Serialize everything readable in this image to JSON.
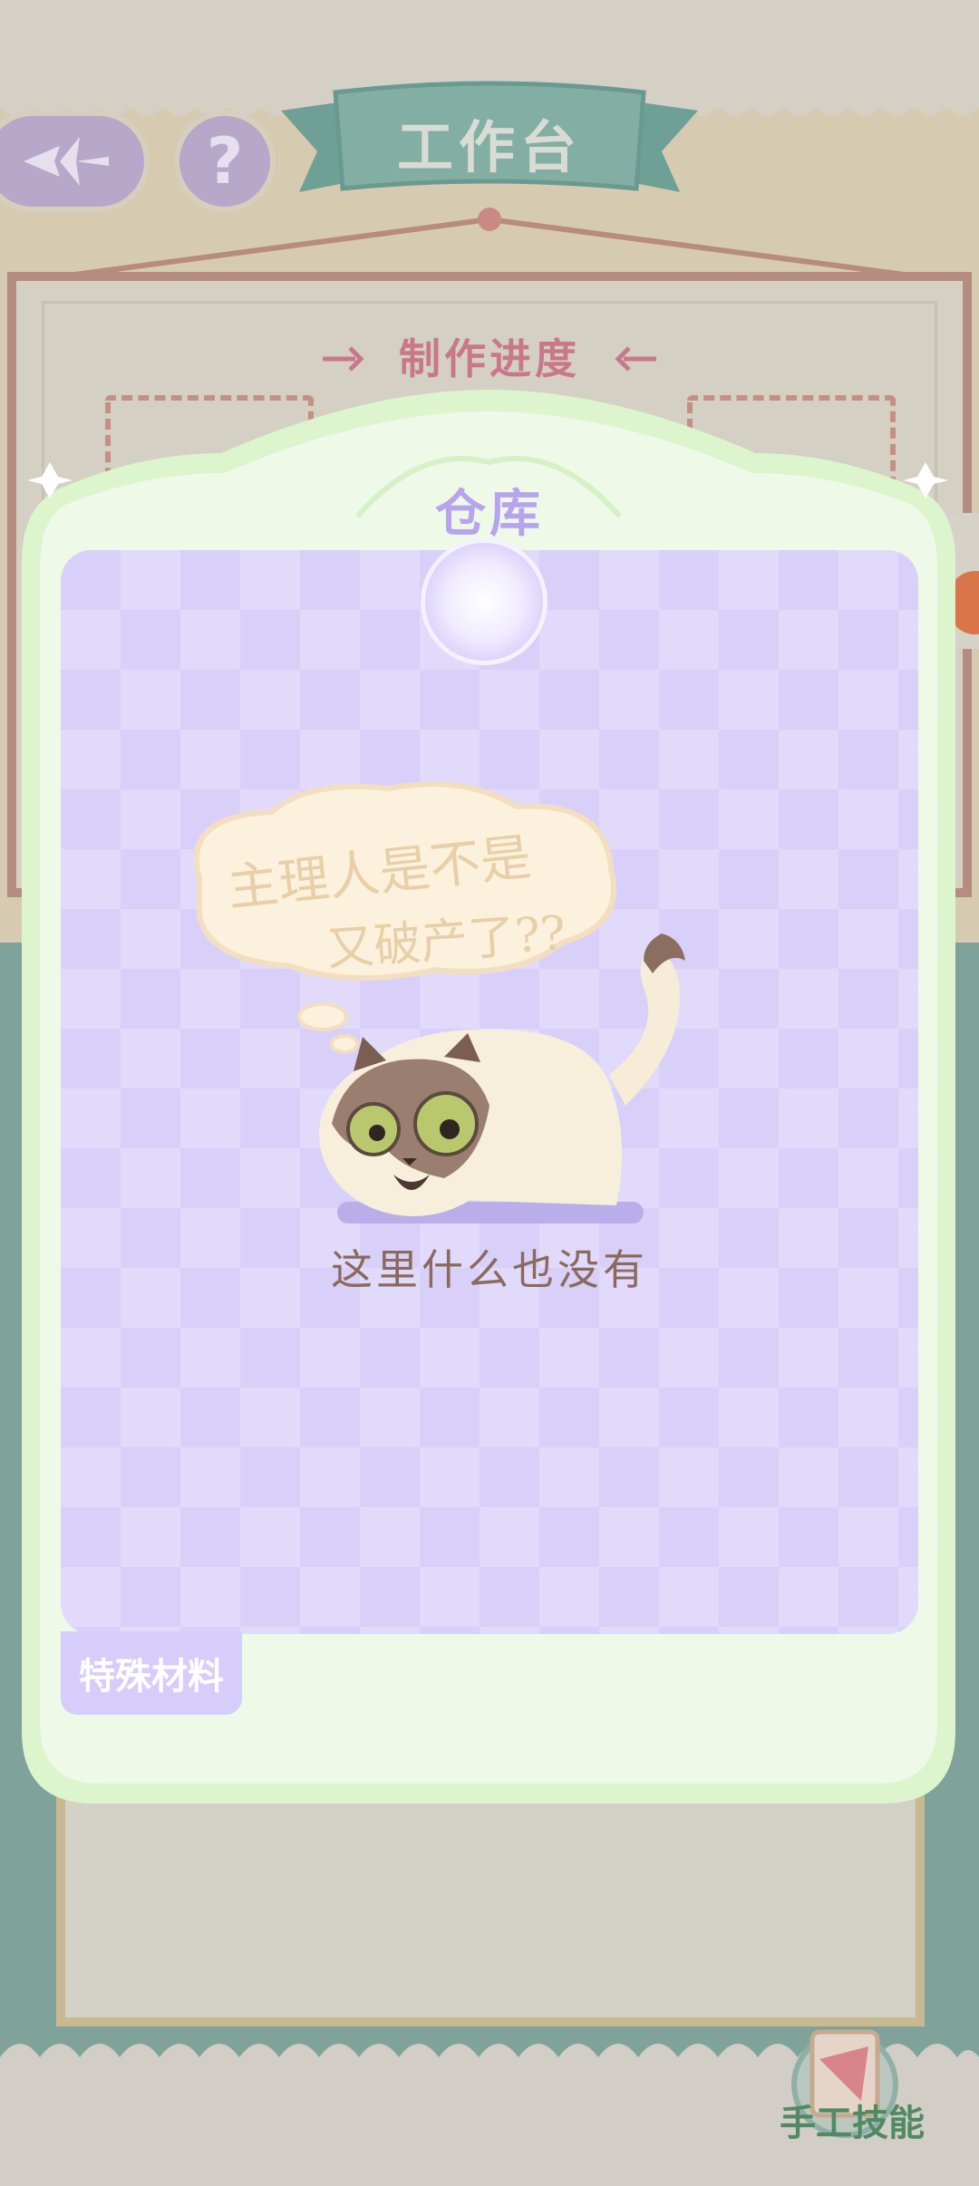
{
  "header": {
    "title": "工作台",
    "help_label": "?"
  },
  "board": {
    "progress_title": "制作进度"
  },
  "warehouse": {
    "title": "仓库",
    "thought_line1": "主理人是不是",
    "thought_line2": "又破产了??",
    "empty_message": "这里什么也没有",
    "tabs": [
      {
        "label": "特殊材料",
        "selected": true
      }
    ]
  },
  "footer": {
    "skill_label": "手工技能"
  },
  "colors": {
    "accent_purple": "#b7a4ec",
    "grid_purple": "#d8d0f8",
    "popup_green": "#edf8e6",
    "popup_border": "#dcf5cd",
    "title_pink": "#c9788c",
    "ribbon_teal": "#7fa9a0",
    "skill_green": "#4f8a62"
  }
}
